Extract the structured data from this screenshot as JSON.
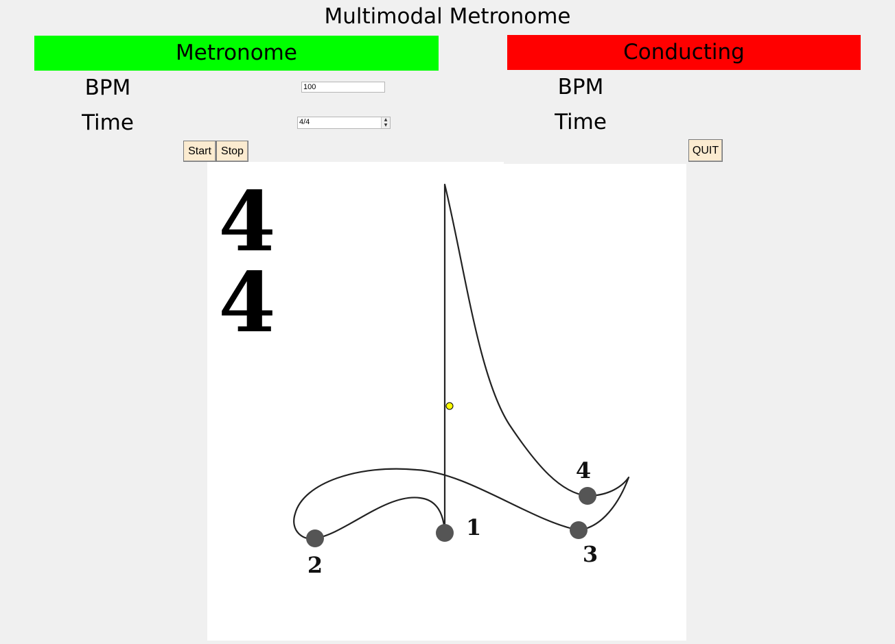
{
  "app": {
    "title": "Multimodal Metronome"
  },
  "metronome": {
    "header": "Metronome",
    "header_color": "#00ff00",
    "bpm_label": "BPM",
    "time_label": "Time",
    "bpm_value": "100",
    "time_value": "4/4",
    "start_label": "Start",
    "stop_label": "Stop"
  },
  "conducting": {
    "header": "Conducting",
    "header_color": "#ff0000",
    "bpm_label": "BPM",
    "time_label": "Time",
    "quit_label": "QUIT"
  },
  "diagram": {
    "time_signature_top": "4",
    "time_signature_bottom": "4",
    "beat_labels": [
      "1",
      "2",
      "3",
      "4"
    ],
    "cursor_color": "#ffff00"
  }
}
